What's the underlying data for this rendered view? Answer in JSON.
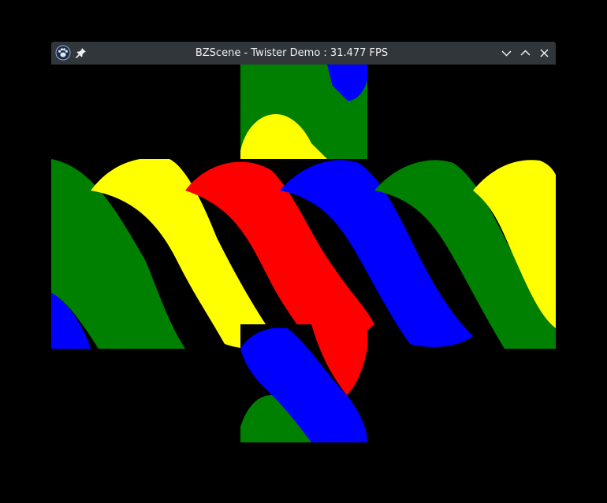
{
  "window": {
    "title": "BZScene - Twister Demo : 31.477 FPS"
  },
  "icons": {
    "app": "bzscene-paw-icon",
    "pin": "pin-icon",
    "minimize": "chevron-down-icon",
    "maximize": "chevron-up-icon",
    "close": "close-icon"
  },
  "colors": {
    "titlebar_bg": "#31363b",
    "titlebar_text": "#eff0f1",
    "scene_bg": "#000000",
    "twister_yellow": "#ffff00",
    "twister_red": "#ff0000",
    "twister_blue": "#0000ff",
    "twister_green": "#008000"
  }
}
